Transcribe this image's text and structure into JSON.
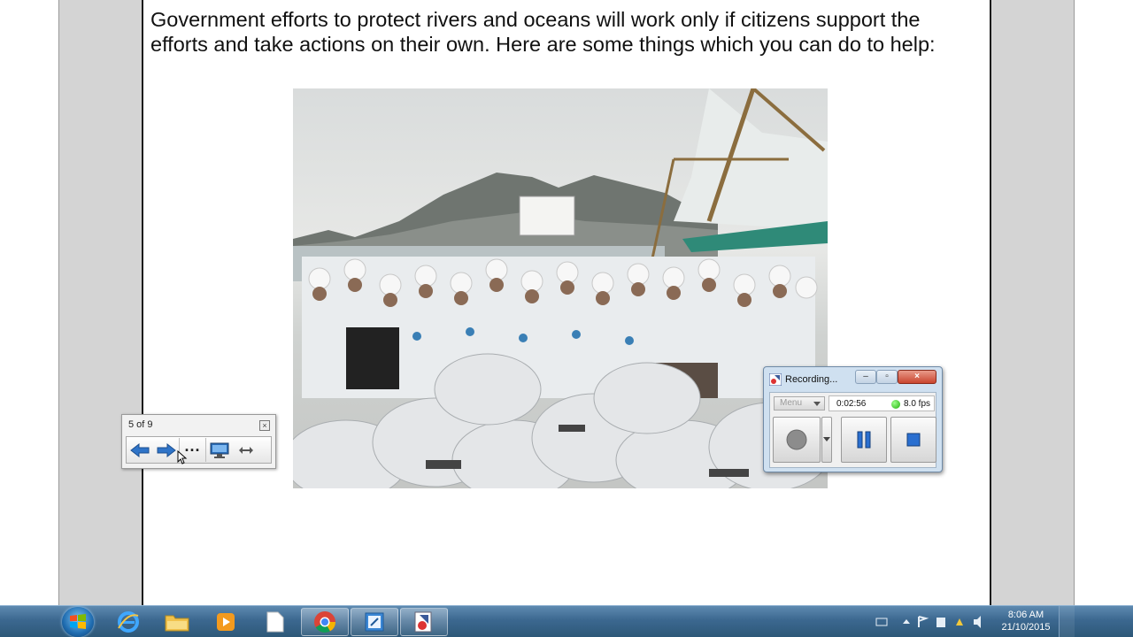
{
  "slide": {
    "body_text": "Government efforts to protect rivers and oceans will work only if citizens support the efforts and take actions on their own.  Here are some things which you can do to help:"
  },
  "slideshow_toolbar": {
    "counter": "5 of 9",
    "close_glyph": "×",
    "more_label": "...",
    "icons": [
      "arrow-left-icon",
      "arrow-right-icon",
      "monitor-icon",
      "resize-icon"
    ]
  },
  "recorder": {
    "title": "Recording...",
    "menu_label": "Menu",
    "elapsed": "0:02:56",
    "fps": "8.0 fps",
    "status_color": "#1faf0b",
    "close_glyph": "×",
    "min_glyph": "–",
    "max_glyph": "▫"
  },
  "taskbar": {
    "apps": [
      "internet-explorer-icon",
      "file-explorer-icon",
      "media-player-icon",
      "document-icon",
      "chrome-icon",
      "notes-icon",
      "recorder-icon"
    ],
    "clock_time": "8:06 AM",
    "clock_date": "21/10/2015"
  },
  "colors": {
    "taskbar": "#3c6890",
    "gutter": "#d4d4d4",
    "nav_arrow": "#2f74c8"
  }
}
